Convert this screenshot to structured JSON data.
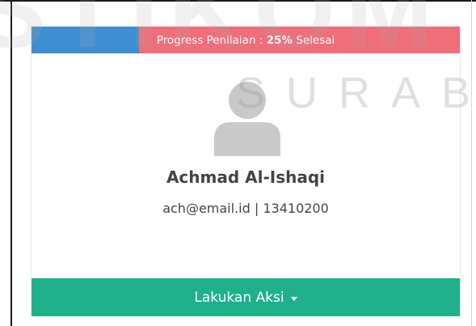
{
  "watermark": {
    "top_text": "STIKOM",
    "city_text": "SURABA"
  },
  "progress": {
    "label_prefix": "Progress Penilaian : ",
    "percent_text": "25%",
    "label_suffix": " Selesai",
    "value": 0.25,
    "fill_color": "#3d8fd1",
    "track_color": "#f06d7a"
  },
  "profile": {
    "avatar_icon": "user-silhouette-icon",
    "name": "Achmad Al-Ishaqi",
    "email": "ach@email.id",
    "separator": "|",
    "id_number": "13410200"
  },
  "action": {
    "label": "Lakukan Aksi",
    "icon": "caret-down-icon",
    "color": "#1fb08c"
  }
}
